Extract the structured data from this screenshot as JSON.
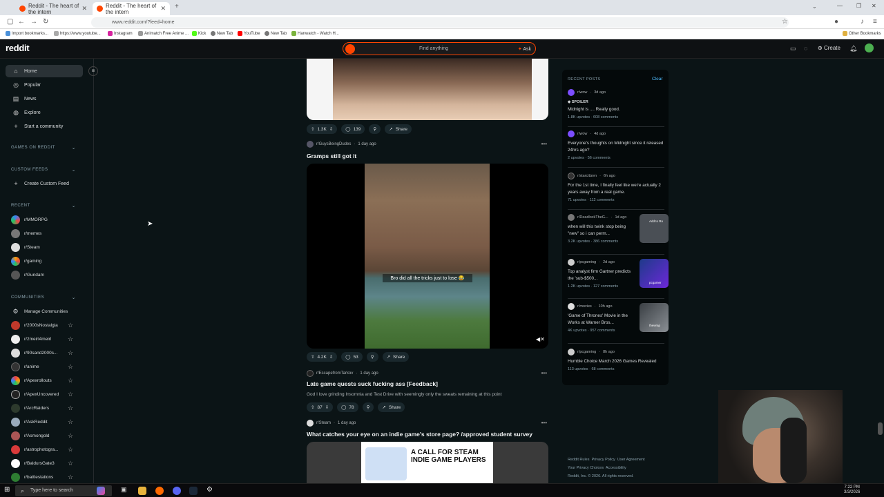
{
  "browser": {
    "tabs": [
      {
        "title": "Reddit - The heart of the intern"
      },
      {
        "title": "Reddit - The heart of the intern"
      }
    ],
    "url": "www.reddit.com/?feed=home",
    "bookmarks": [
      "Import bookmarks...",
      "https://www.youtube...",
      "Instagram",
      "Animatch Free Anime ...",
      "Kick",
      "New Tab",
      "YouTube",
      "New Tab",
      "Hanwatch - Watch H..."
    ],
    "other_bookmarks": "Other Bookmarks"
  },
  "header": {
    "logo": "reddit",
    "search_placeholder": "Find anything",
    "ask": "Ask",
    "create": "Create"
  },
  "sidebar": {
    "nav": [
      {
        "label": "Home",
        "icon": "home-icon"
      },
      {
        "label": "Popular",
        "icon": "popular-icon"
      },
      {
        "label": "News",
        "icon": "news-icon"
      },
      {
        "label": "Explore",
        "icon": "explore-icon"
      },
      {
        "label": "Start a community",
        "icon": "plus-icon"
      }
    ],
    "games_heading": "GAMES ON REDDIT",
    "custom_heading": "CUSTOM FEEDS",
    "create_custom": "Create Custom Feed",
    "recent_heading": "RECENT",
    "recent": [
      "r/MMORPG",
      "r/memes",
      "r/Steam",
      "r/gaming",
      "r/Gundam"
    ],
    "communities_heading": "COMMUNITIES",
    "manage": "Manage Communities",
    "communities": [
      "r/2000sNostalgia",
      "r/2meirl4meirl",
      "r/90sand2000s...",
      "r/anime",
      "r/Apexrollouts",
      "r/ApexUncovered",
      "r/ArcRaiders",
      "r/AskReddit",
      "r/Asmongold",
      "r/astrophotogra...",
      "r/BaldursGate3",
      "r/battlestations"
    ]
  },
  "feed": {
    "post0": {
      "votes": "1.3K",
      "comments": "139",
      "share": "Share"
    },
    "post1": {
      "sub": "r/GuysBeingDudes",
      "time": "1 day ago",
      "title": "Gramps still got it",
      "caption": "Bro did all the tricks just to lose 😂",
      "votes": "4.2K",
      "comments": "53",
      "share": "Share"
    },
    "post2": {
      "sub": "r/EscapefromTarkov",
      "time": "1 day ago",
      "title": "Late game quests suck fucking ass [Feedback]",
      "body": "God I love grinding Insomnia and Test Drive with seemingly only the sweats remaining at this point",
      "votes": "87",
      "comments": "78",
      "share": "Share"
    },
    "post3": {
      "sub": "r/Steam",
      "time": "1 day ago",
      "title": "What catches your eye on an indie game's store page? /approved student survey",
      "banner": "A CALL FOR STEAM INDIE GAME PLAYERS"
    }
  },
  "recent_posts": {
    "heading": "RECENT POSTS",
    "clear": "Clear",
    "items": [
      {
        "sub": "r/wow",
        "time": "3d ago",
        "spoiler": "SPOILER",
        "title": "Midnight is .... Really good.",
        "stats": "1.8K upvotes · 608 comments"
      },
      {
        "sub": "r/wow",
        "time": "4d ago",
        "title": "Everyone's thoughts on Midnight since it released 24hrs ago?",
        "stats": "2 upvotes · 56 comments"
      },
      {
        "sub": "r/starcitizen",
        "time": "6h ago",
        "title": "For the 1st time, I finally feel like we're actually 2 years away from a real game.",
        "stats": "71 upvotes · 112 comments"
      },
      {
        "sub": "r/DeadlockTheG...",
        "time": "1d ago",
        "title": "when will this twink stop being \"new\" so i can perm...",
        "stats": "3.2K upvotes · 386 comments"
      },
      {
        "sub": "r/pcgaming",
        "time": "2d ago",
        "title": "Top analyst firm Gartner predicts the 'sub-$500...",
        "stats": "1.2K upvotes · 127 comments"
      },
      {
        "sub": "r/movies",
        "time": "10h ago",
        "title": "'Game of Thrones' Movie in the Works at Warner Bros...",
        "stats": "4K upvotes · 957 comments"
      },
      {
        "sub": "r/pcgaming",
        "time": "8h ago",
        "title": "Humble Choice March 2026 Games Revealed",
        "stats": "113 upvotes · 68 comments"
      }
    ],
    "thumb_text_1": "Add to Ro",
    "thumb_text_2": "pcgamer",
    "thumb_text_3": "thewrap"
  },
  "footer": {
    "l1a": "Reddit Rules",
    "l1b": "Privacy Policy",
    "l1c": "User Agreement",
    "l2a": "Your Privacy Choices",
    "l2b": "Accessibility",
    "l3": "Reddit, Inc. © 2026. All rights reserved."
  },
  "taskbar": {
    "search": "Type here to search",
    "time": "7:22 PM",
    "date": "3/3/2026"
  }
}
